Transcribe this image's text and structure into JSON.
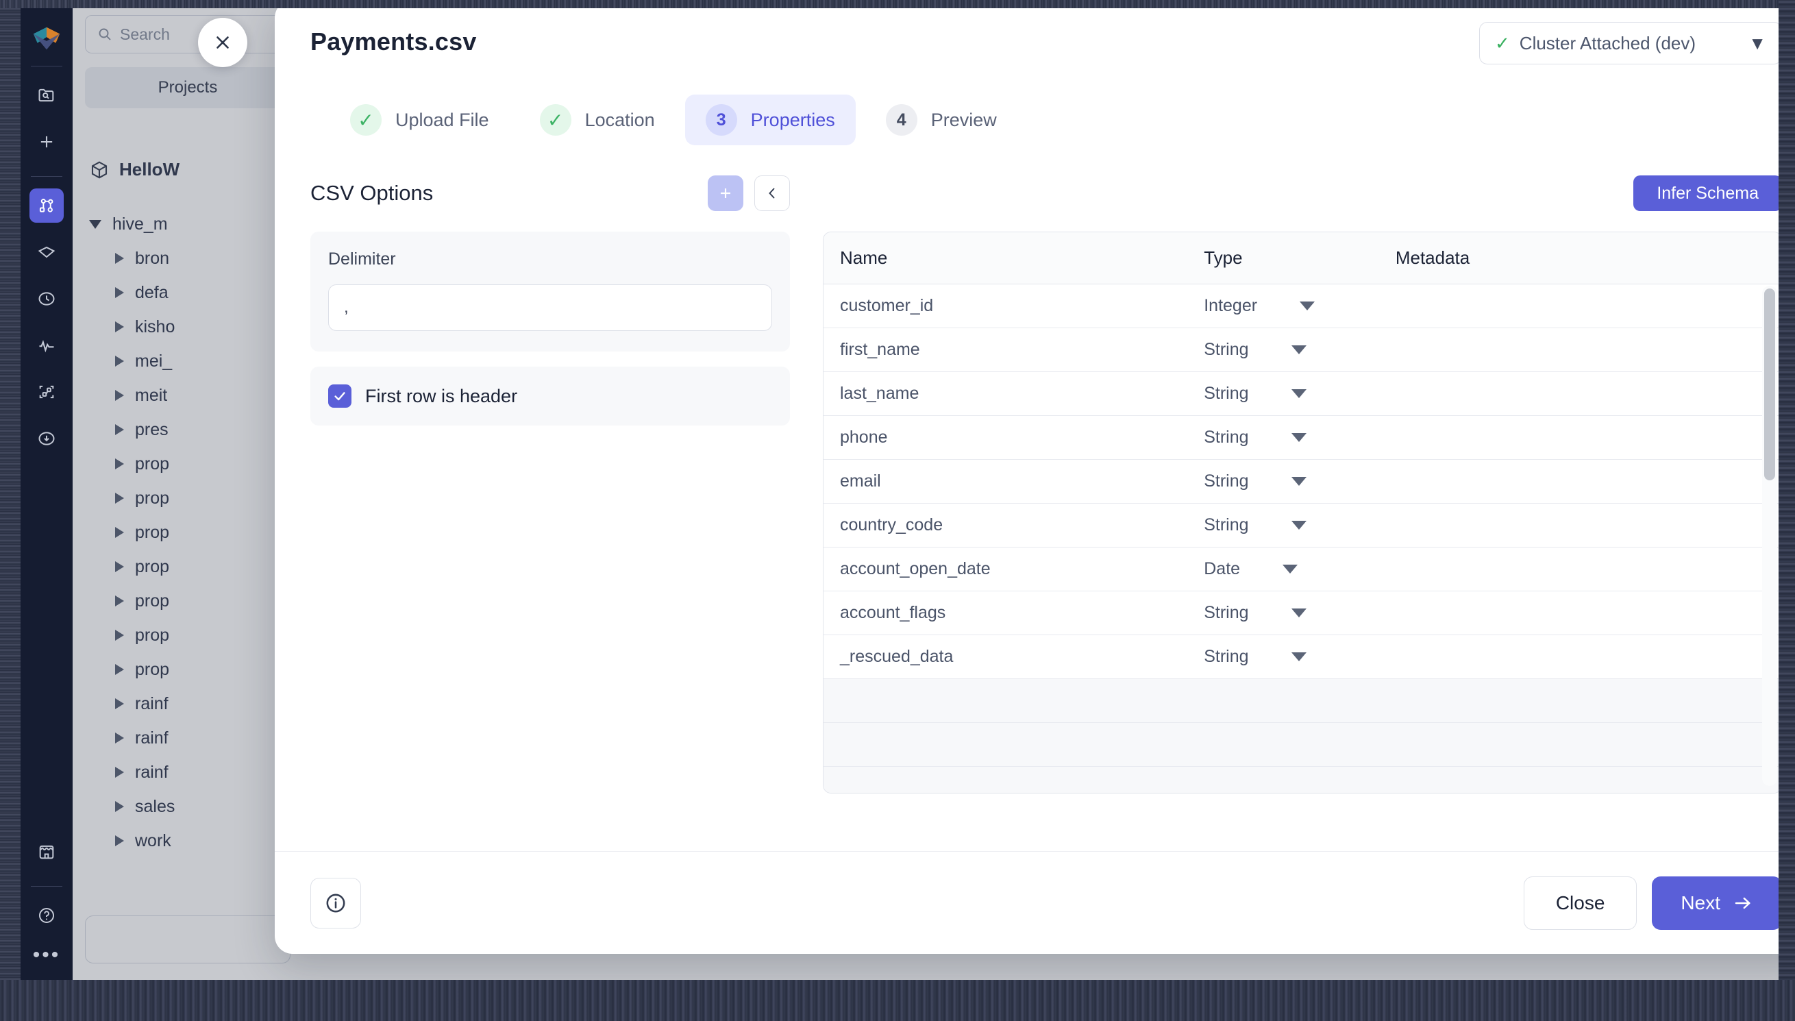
{
  "window": {
    "rail": {
      "logo_icon": "databricks-logo-icon",
      "items": [
        {
          "name": "catalog-search-icon",
          "icon": "folder-search-icon",
          "active": false
        },
        {
          "name": "new-item-icon",
          "icon": "plus-icon",
          "active": false
        },
        {
          "name": "workflows-icon",
          "icon": "graph-nodes-icon",
          "active": true
        },
        {
          "name": "data-icon",
          "icon": "diamond-icon",
          "active": false
        },
        {
          "name": "history-icon",
          "icon": "clock-icon",
          "active": false
        },
        {
          "name": "monitoring-icon",
          "icon": "pulse-icon",
          "active": false
        },
        {
          "name": "lineage-icon",
          "icon": "nodes-square-icon",
          "active": false
        },
        {
          "name": "ingest-icon",
          "icon": "download-circle-icon",
          "active": false
        },
        {
          "name": "marketplace-icon",
          "icon": "store-icon",
          "active": false
        },
        {
          "name": "help-icon",
          "icon": "question-circle-icon",
          "active": false
        }
      ],
      "more_icon": "ellipsis-icon"
    },
    "background": {
      "search_placeholder": "Search",
      "search_icon": "search-icon",
      "projects_label": "Projects",
      "workspace": {
        "icon": "cube-icon",
        "label": "HelloW"
      },
      "tree": [
        {
          "label": "hive_m",
          "expanded": true,
          "level": 0
        },
        {
          "label": "bron",
          "expanded": false,
          "level": 1
        },
        {
          "label": "defa",
          "expanded": false,
          "level": 1
        },
        {
          "label": "kisho",
          "expanded": false,
          "level": 1
        },
        {
          "label": "mei_",
          "expanded": false,
          "level": 1
        },
        {
          "label": "meit",
          "expanded": false,
          "level": 1
        },
        {
          "label": "pres",
          "expanded": false,
          "level": 1
        },
        {
          "label": "prop",
          "expanded": false,
          "level": 1
        },
        {
          "label": "prop",
          "expanded": false,
          "level": 1
        },
        {
          "label": "prop",
          "expanded": false,
          "level": 1
        },
        {
          "label": "prop",
          "expanded": false,
          "level": 1
        },
        {
          "label": "prop",
          "expanded": false,
          "level": 1
        },
        {
          "label": "prop",
          "expanded": false,
          "level": 1
        },
        {
          "label": "prop",
          "expanded": false,
          "level": 1
        },
        {
          "label": "rainf",
          "expanded": false,
          "level": 1
        },
        {
          "label": "rainf",
          "expanded": false,
          "level": 1
        },
        {
          "label": "rainf",
          "expanded": false,
          "level": 1
        },
        {
          "label": "sales",
          "expanded": false,
          "level": 1
        },
        {
          "label": "work",
          "expanded": false,
          "level": 1
        }
      ]
    }
  },
  "modal": {
    "close_icon": "close-icon",
    "title": "Payments.csv",
    "cluster": {
      "status_icon": "check-icon",
      "label": "Cluster Attached (dev)",
      "chevron_icon": "chevron-down-icon"
    },
    "steps": [
      {
        "badge": "✓",
        "label": "Upload File",
        "state": "done"
      },
      {
        "badge": "✓",
        "label": "Location",
        "state": "done"
      },
      {
        "badge": "3",
        "label": "Properties",
        "state": "current"
      },
      {
        "badge": "4",
        "label": "Preview",
        "state": "pending"
      }
    ],
    "options": {
      "title": "CSV Options",
      "add_icon": "plus-icon",
      "collapse_icon": "chevron-left-icon",
      "delimiter_label": "Delimiter",
      "delimiter_value": ",",
      "delimiter_placeholder": ",",
      "header_checkbox_label": "First row is header",
      "header_checkbox_checked": true,
      "check_icon": "check-icon"
    },
    "schema": {
      "infer_button": "Infer Schema",
      "columns": [
        "Name",
        "Type",
        "Metadata"
      ],
      "rows": [
        {
          "name": "customer_id",
          "type": "Integer",
          "metadata": ""
        },
        {
          "name": "first_name",
          "type": "String",
          "metadata": ""
        },
        {
          "name": "last_name",
          "type": "String",
          "metadata": ""
        },
        {
          "name": "phone",
          "type": "String",
          "metadata": ""
        },
        {
          "name": "email",
          "type": "String",
          "metadata": ""
        },
        {
          "name": "country_code",
          "type": "String",
          "metadata": ""
        },
        {
          "name": "account_open_date",
          "type": "Date",
          "metadata": ""
        },
        {
          "name": "account_flags",
          "type": "String",
          "metadata": ""
        },
        {
          "name": "_rescued_data",
          "type": "String",
          "metadata": ""
        }
      ],
      "empty_row_count": 3,
      "type_caret_icon": "caret-down-icon"
    },
    "footer": {
      "info_icon": "info-circle-icon",
      "close_label": "Close",
      "next_label": "Next",
      "next_icon": "arrow-right-icon"
    }
  },
  "colors": {
    "accent": "#5a5fd8",
    "accent_soft": "#eceefe",
    "success": "#38b05f",
    "rail_bg": "#151c31"
  }
}
